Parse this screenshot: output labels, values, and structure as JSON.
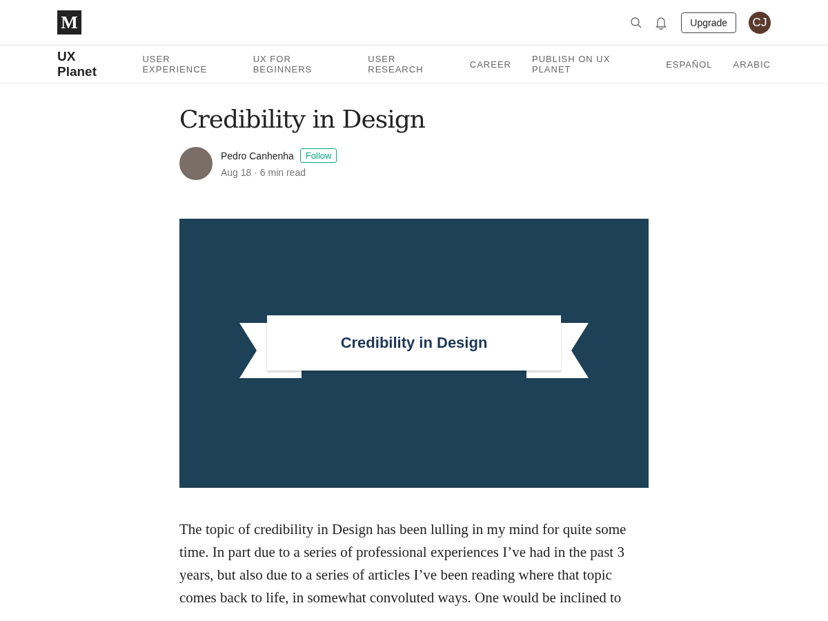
{
  "header": {
    "logo": "M",
    "upgrade": "Upgrade",
    "avatar": "CJ"
  },
  "publication": {
    "name": "UX Planet",
    "nav": [
      "USER EXPERIENCE",
      "UX FOR BEGINNERS",
      "USER RESEARCH",
      "CAREER",
      "PUBLISH ON UX PLANET",
      "ESPAÑOL",
      "ARABIC"
    ]
  },
  "article": {
    "title": "Credibility in Design",
    "author": "Pedro Canhenha",
    "follow": "Follow",
    "meta": "Aug 18 · 6 min read",
    "hero_banner": "Credibility in Design",
    "body": "The topic of credibility in Design has been lulling in my mind for quite some time. In part due to a series of professional experiences I’ve had in the past 3 years, but also due to a series of articles I’ve been reading where that topic comes back to life, in somewhat convoluted ways. One would be inclined to"
  }
}
